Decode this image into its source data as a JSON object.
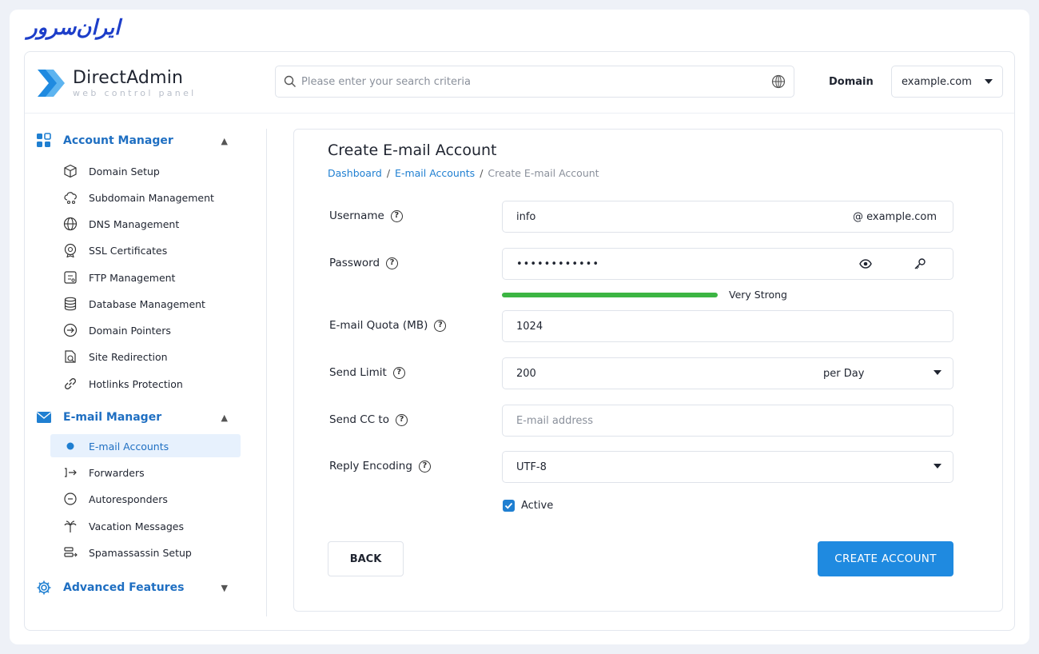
{
  "brand": {
    "logo_text": "ایران‌سرور"
  },
  "header": {
    "app_title": "DirectAdmin",
    "app_subtitle": "web control panel",
    "search_placeholder": "Please enter your search criteria",
    "domain_label": "Domain",
    "domain_value": "example.com"
  },
  "sidebar": {
    "sections": [
      {
        "label": "Account Manager",
        "icon": "grid-icon",
        "expanded": true,
        "items": [
          "Domain Setup",
          "Subdomain Management",
          "DNS Management",
          "SSL Certificates",
          "FTP Management",
          "Database Management",
          "Domain Pointers",
          "Site Redirection",
          "Hotlinks Protection"
        ]
      },
      {
        "label": "E-mail Manager",
        "icon": "envelope-icon",
        "expanded": true,
        "items": [
          "E-mail Accounts",
          "Forwarders",
          "Autoresponders",
          "Vacation Messages",
          "Spamassassin Setup"
        ]
      },
      {
        "label": "Advanced Features",
        "icon": "gear-icon",
        "expanded": false,
        "items": []
      }
    ],
    "active_item": "E-mail Accounts"
  },
  "page": {
    "title": "Create E-mail Account",
    "breadcrumb": [
      "Dashboard",
      "E-mail Accounts",
      "Create E-mail Account"
    ]
  },
  "form": {
    "username": {
      "label": "Username",
      "value": "info",
      "suffix": "@ example.com"
    },
    "password": {
      "label": "Password",
      "value": "••••••••••••",
      "strength_text": "Very Strong",
      "strength_fraction": 1.0
    },
    "quota": {
      "label": "E-mail Quota (MB)",
      "value": "1024"
    },
    "send_limit": {
      "label": "Send Limit",
      "value": "200",
      "period": "per Day"
    },
    "send_cc": {
      "label": "Send CC to",
      "placeholder": "E-mail address"
    },
    "reply_encoding": {
      "label": "Reply Encoding",
      "value": "UTF-8"
    },
    "active": {
      "label": "Active",
      "checked": true
    }
  },
  "buttons": {
    "back": "BACK",
    "create": "CREATE ACCOUNT"
  },
  "colors": {
    "accent": "#1f8ae0",
    "link": "#1f7fd1",
    "strength": "#3cb543",
    "brand": "#1d3ec9"
  }
}
